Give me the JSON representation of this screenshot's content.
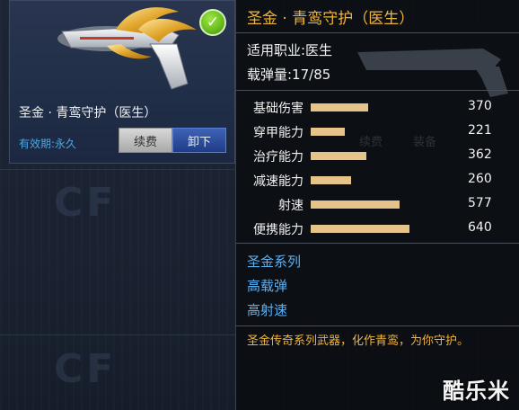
{
  "item_card": {
    "name": "圣金 · 青鸾守护（医生）",
    "validity": "有效期:永久",
    "renew_label": "续费",
    "unequip_label": "卸下",
    "equipped_icon": "check-icon"
  },
  "background": {
    "ghost_renew_label": "续费",
    "ghost_equip_label": "装备"
  },
  "info_panel": {
    "title": "圣金 · 青鸾守护（医生）",
    "profession": "适用职业:医生",
    "ammo": "载弹量:17/85",
    "stats": [
      {
        "label": "基础伤害",
        "value": "370",
        "fill": 0.578
      },
      {
        "label": "穿甲能力",
        "value": "221",
        "fill": 0.345
      },
      {
        "label": "治疗能力",
        "value": "362",
        "fill": 0.566
      },
      {
        "label": "减速能力",
        "value": "260",
        "fill": 0.406
      },
      {
        "label": "射速",
        "value": "577",
        "fill": 0.902
      },
      {
        "label": "便携能力",
        "value": "640",
        "fill": 1.0
      }
    ],
    "tags": [
      "圣金系列",
      "高载弹",
      "高射速"
    ],
    "description": "圣金传奇系列武器，化作青鸾，为你守护。"
  },
  "watermark": "酷乐米",
  "colors": {
    "title_gold": "#f0b43a",
    "tag_blue": "#5bb0f2",
    "bar_tan": "#e6c489",
    "equipped_green": "#6bbf1e"
  }
}
